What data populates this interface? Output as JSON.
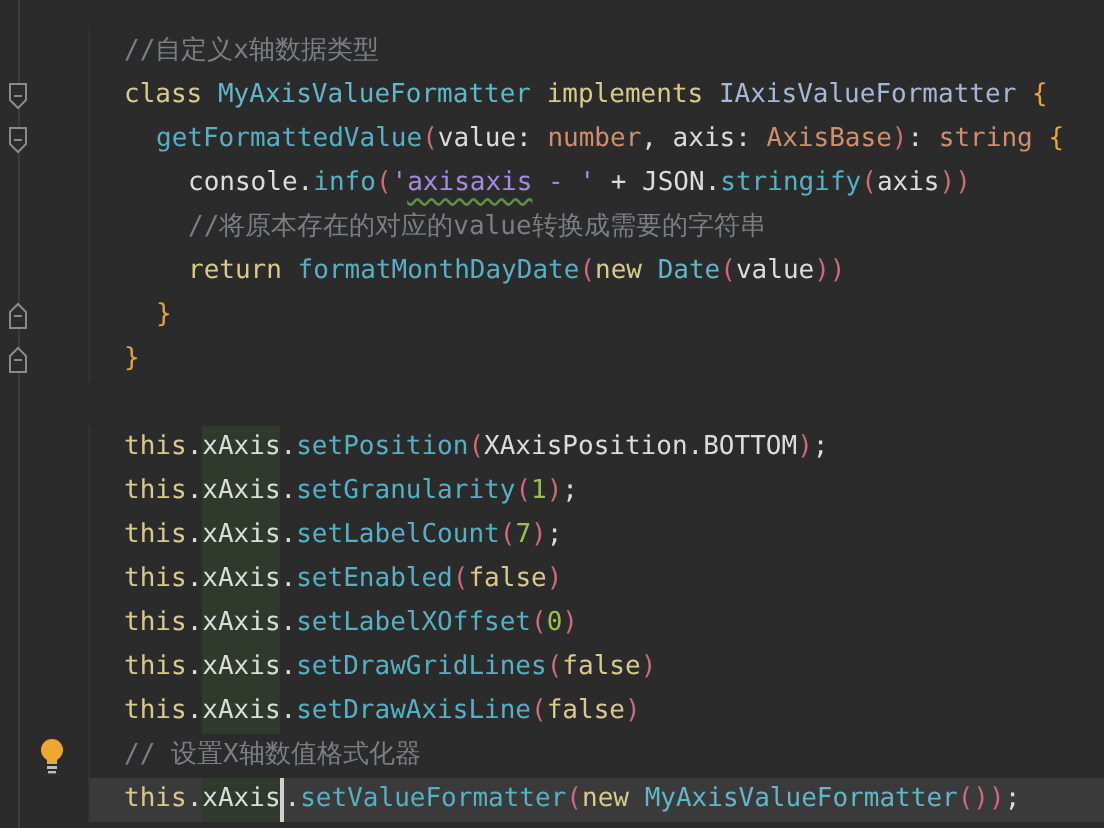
{
  "editor": {
    "blocks": [
      {
        "lines": [
          {
            "tokens": [
              {
                "text": "//自定义x轴数据类型",
                "kind": "comment"
              }
            ]
          },
          {
            "fold_start": true,
            "tokens": [
              {
                "text": "class ",
                "kind": "keyword"
              },
              {
                "text": "MyAxisValueFormatter ",
                "kind": "class"
              },
              {
                "text": "implements ",
                "kind": "keyword"
              },
              {
                "text": "IAxisValueFormatter ",
                "kind": "iface"
              },
              {
                "text": "{",
                "kind": "brace"
              }
            ],
            "children": [
              {
                "fold_start": true,
                "tokens": [
                  {
                    "text": "getFormattedValue",
                    "kind": "method"
                  },
                  {
                    "text": "(",
                    "kind": "paren"
                  },
                  {
                    "text": "value: ",
                    "kind": "plain"
                  },
                  {
                    "text": "number",
                    "kind": "type"
                  },
                  {
                    "text": ", axis: ",
                    "kind": "plain"
                  },
                  {
                    "text": "AxisBase",
                    "kind": "type"
                  },
                  {
                    "text": ")",
                    "kind": "paren"
                  },
                  {
                    "text": ": ",
                    "kind": "plain"
                  },
                  {
                    "text": "string ",
                    "kind": "type"
                  },
                  {
                    "text": "{",
                    "kind": "brace"
                  }
                ],
                "children": [
                  {
                    "tokens": [
                      {
                        "text": "console.",
                        "kind": "plain"
                      },
                      {
                        "text": "info",
                        "kind": "method"
                      },
                      {
                        "text": "(",
                        "kind": "paren"
                      },
                      {
                        "text": "'",
                        "kind": "string"
                      },
                      {
                        "text": "axisaxis",
                        "kind": "string",
                        "typo": true
                      },
                      {
                        "text": " - '",
                        "kind": "string"
                      },
                      {
                        "text": " + JSON.",
                        "kind": "plain"
                      },
                      {
                        "text": "stringify",
                        "kind": "method"
                      },
                      {
                        "text": "(",
                        "kind": "paren"
                      },
                      {
                        "text": "axis",
                        "kind": "plain"
                      },
                      {
                        "text": "))",
                        "kind": "paren"
                      }
                    ]
                  },
                  {
                    "tokens": [
                      {
                        "text": "//将原本存在的对应的value转换成需要的字符串",
                        "kind": "comment"
                      }
                    ]
                  },
                  {
                    "tokens": [
                      {
                        "text": "return ",
                        "kind": "keyword"
                      },
                      {
                        "text": "formatMonthDayDate",
                        "kind": "method"
                      },
                      {
                        "text": "(",
                        "kind": "paren"
                      },
                      {
                        "text": "new ",
                        "kind": "keyword"
                      },
                      {
                        "text": "Date",
                        "kind": "class"
                      },
                      {
                        "text": "(",
                        "kind": "paren"
                      },
                      {
                        "text": "value",
                        "kind": "plain"
                      },
                      {
                        "text": "))",
                        "kind": "paren"
                      }
                    ]
                  }
                ]
              },
              {
                "fold_end": true,
                "tokens": [
                  {
                    "text": "}",
                    "kind": "brace"
                  }
                ]
              }
            ]
          },
          {
            "fold_end": true,
            "tokens": [
              {
                "text": "}",
                "kind": "brace"
              }
            ]
          }
        ]
      },
      {
        "lines": [
          {
            "tokens": [
              {
                "text": "this",
                "kind": "keyword"
              },
              {
                "text": ".",
                "kind": "plain"
              },
              {
                "text": "xAxis",
                "kind": "plain",
                "highlight": true
              },
              {
                "text": ".",
                "kind": "plain"
              },
              {
                "text": "setPosition",
                "kind": "method"
              },
              {
                "text": "(",
                "kind": "paren"
              },
              {
                "text": "XAxisPosition.BOTTOM",
                "kind": "plain"
              },
              {
                "text": ")",
                "kind": "paren"
              },
              {
                "text": ";",
                "kind": "plain"
              }
            ]
          },
          {
            "tokens": [
              {
                "text": "this",
                "kind": "keyword"
              },
              {
                "text": ".",
                "kind": "plain"
              },
              {
                "text": "xAxis",
                "kind": "plain",
                "highlight": true
              },
              {
                "text": ".",
                "kind": "plain"
              },
              {
                "text": "setGranularity",
                "kind": "method"
              },
              {
                "text": "(",
                "kind": "paren"
              },
              {
                "text": "1",
                "kind": "number"
              },
              {
                "text": ")",
                "kind": "paren"
              },
              {
                "text": ";",
                "kind": "plain"
              }
            ]
          },
          {
            "tokens": [
              {
                "text": "this",
                "kind": "keyword"
              },
              {
                "text": ".",
                "kind": "plain"
              },
              {
                "text": "xAxis",
                "kind": "plain",
                "highlight": true
              },
              {
                "text": ".",
                "kind": "plain"
              },
              {
                "text": "setLabelCount",
                "kind": "method"
              },
              {
                "text": "(",
                "kind": "paren"
              },
              {
                "text": "7",
                "kind": "number"
              },
              {
                "text": ")",
                "kind": "paren"
              },
              {
                "text": ";",
                "kind": "plain"
              }
            ]
          },
          {
            "tokens": [
              {
                "text": "this",
                "kind": "keyword"
              },
              {
                "text": ".",
                "kind": "plain"
              },
              {
                "text": "xAxis",
                "kind": "plain",
                "highlight": true
              },
              {
                "text": ".",
                "kind": "plain"
              },
              {
                "text": "setEnabled",
                "kind": "method"
              },
              {
                "text": "(",
                "kind": "paren"
              },
              {
                "text": "false",
                "kind": "keyword"
              },
              {
                "text": ")",
                "kind": "paren"
              }
            ]
          },
          {
            "tokens": [
              {
                "text": "this",
                "kind": "keyword"
              },
              {
                "text": ".",
                "kind": "plain"
              },
              {
                "text": "xAxis",
                "kind": "plain",
                "highlight": true
              },
              {
                "text": ".",
                "kind": "plain"
              },
              {
                "text": "setLabelXOffset",
                "kind": "method"
              },
              {
                "text": "(",
                "kind": "paren"
              },
              {
                "text": "0",
                "kind": "number"
              },
              {
                "text": ")",
                "kind": "paren"
              }
            ]
          },
          {
            "tokens": [
              {
                "text": "this",
                "kind": "keyword"
              },
              {
                "text": ".",
                "kind": "plain"
              },
              {
                "text": "xAxis",
                "kind": "plain",
                "highlight": true
              },
              {
                "text": ".",
                "kind": "plain"
              },
              {
                "text": "setDrawGridLines",
                "kind": "method"
              },
              {
                "text": "(",
                "kind": "paren"
              },
              {
                "text": "false",
                "kind": "keyword"
              },
              {
                "text": ")",
                "kind": "paren"
              }
            ]
          },
          {
            "tokens": [
              {
                "text": "this",
                "kind": "keyword"
              },
              {
                "text": ".",
                "kind": "plain"
              },
              {
                "text": "xAxis",
                "kind": "plain",
                "highlight": true
              },
              {
                "text": ".",
                "kind": "plain"
              },
              {
                "text": "setDrawAxisLine",
                "kind": "method"
              },
              {
                "text": "(",
                "kind": "paren"
              },
              {
                "text": "false",
                "kind": "keyword"
              },
              {
                "text": ")",
                "kind": "paren"
              }
            ]
          },
          {
            "lightbulb": true,
            "tokens": [
              {
                "text": "// 设置X轴数值格式化器",
                "kind": "comment"
              }
            ]
          },
          {
            "selected": true,
            "tokens": [
              {
                "text": "this",
                "kind": "keyword"
              },
              {
                "text": ".",
                "kind": "plain"
              },
              {
                "text": "xAxis",
                "kind": "plain",
                "highlight": true,
                "caret": true
              },
              {
                "text": ".",
                "kind": "plain"
              },
              {
                "text": "setValueFormatter",
                "kind": "method"
              },
              {
                "text": "(",
                "kind": "paren"
              },
              {
                "text": "new ",
                "kind": "keyword"
              },
              {
                "text": "MyAxisValueFormatter",
                "kind": "class"
              },
              {
                "text": "()",
                "kind": "paren"
              },
              {
                "text": ")",
                "kind": "paren"
              },
              {
                "text": ";",
                "kind": "plain"
              }
            ]
          }
        ]
      }
    ]
  }
}
